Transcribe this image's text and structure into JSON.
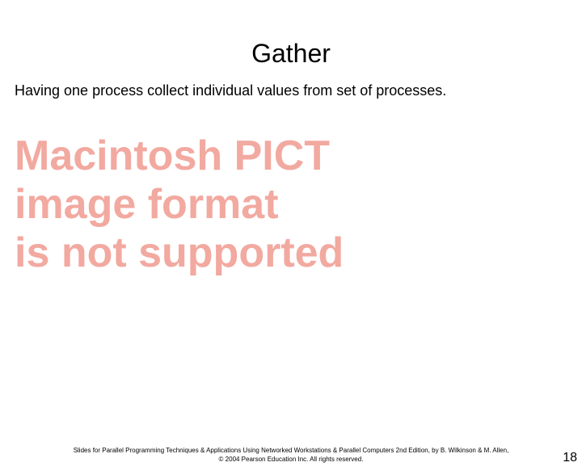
{
  "slide": {
    "title": "Gather",
    "body": "Having one process collect individual values from set of processes."
  },
  "placeholder": {
    "line1": "Macintosh PICT",
    "line2": "image format",
    "line3": "is not supported"
  },
  "footer": {
    "line1": "Slides for Parallel Programming Techniques & Applications Using Networked Workstations & Parallel Computers 2nd Edition, by B. Wilkinson & M. Allen,",
    "line2": "© 2004 Pearson Education Inc. All rights reserved."
  },
  "page_number": "18"
}
